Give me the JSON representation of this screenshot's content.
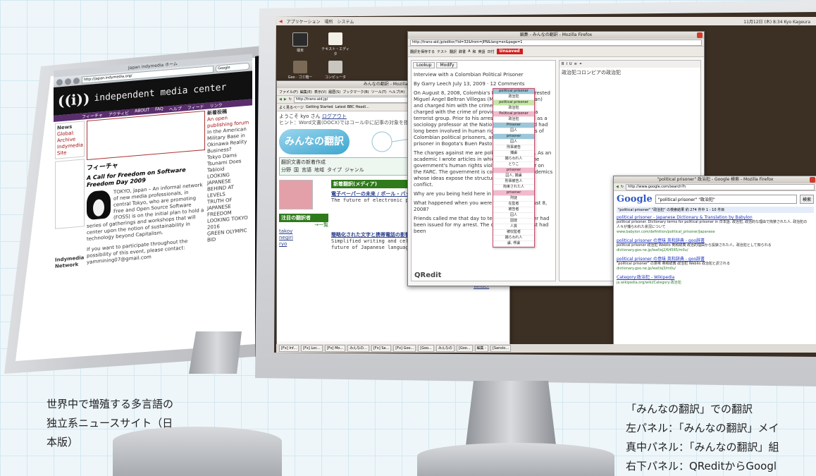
{
  "captions": {
    "left": {
      "line1": "世界中で増殖する多言語の",
      "line2": "独立系ニュースサイト（日",
      "line3": "本版）"
    },
    "right": {
      "line1": "「みんなの翻訳」での翻訳",
      "line2": "左パネル：「みんなの翻訳」メイ",
      "line3": "真中パネル：「みんなの翻訳」組",
      "line4": "右下パネル：QReditからGoogl"
    }
  },
  "left_browser": {
    "window_title": "Japan indymedia ホーム",
    "url": "http://japan.indymedia.org/",
    "search_placeholder": "Google",
    "site_logo": "((i))",
    "site_name": "independent media center",
    "nav": [
      "フィーチャ",
      "アクティビ",
      "ABOUT",
      "FAQ",
      "ヘルプ",
      "フィード",
      "リンク"
    ],
    "left_heading": "News",
    "left_items": [
      "Global: Archive",
      "Indymedia Site"
    ],
    "article_heading": "フィーチャ",
    "article_title": "A Call for Freedom on Software Freedom Day 2009",
    "article_body": "TOKYO, Japan – An informal network of new media professionals, in central Tokyo, who are promoting Free and Open Source Software (FOSS) is on the initial plan to hold a series of gatherings and workshops that will center upon the notion of sustainability in technology beyond Capitalism.",
    "article_footer": "If you want to participate throughout the possibility of this event, please contact: yammining07@gmail.com",
    "right_heading": "新着投稿",
    "right_items": [
      "An open publishing forum",
      "In the American Military Base in Okinawa Reality Business?",
      "Tokyo Dams",
      "Tsunami Does Tabloid",
      "LOOKING JAPANESE BEHIND AT LEVELS",
      "TRUTH OF JAPANESE FREEDOM",
      "LOOKING TOKYO 2016",
      "GREEN OLYMPIC BID"
    ],
    "bottom_label": "Indymedia Network"
  },
  "right_screen": {
    "top_panel": {
      "menu": [
        "アプリケーション",
        "場所",
        "システム"
      ],
      "status": "11月12日 (木) 8:34  Kyo Kageura"
    },
    "desktop_icons": [
      "端末",
      "テキスト・エディタ",
      "Geo · ゴミ箱ー",
      "コンピュータ"
    ],
    "minna_window": {
      "title": "みんなの翻訳 - Mozilla Firefox",
      "menu": [
        "ファイル(F)",
        "編集(E)",
        "表示(V)",
        "履歴(S)",
        "ブックマーク(B)",
        "ツール(T)",
        "ヘルプ(H)"
      ],
      "url": "http://trans-aid.jp/",
      "bookmarks": [
        "よく見るページ",
        "Getting Started",
        "Latest BBC Headl..."
      ],
      "welcome": "ようこそ kyo さん",
      "logout": "ログアウト",
      "notice": "ヒント：Word文書(DOCX)ではコール中に記事の対象を指定することができます。",
      "logo": "みんなの翻訳",
      "search_label": "翻訳文書の新着作成",
      "categories": [
        "分野",
        "国",
        "言語",
        "地域",
        "タイプ",
        "ジャンル"
      ],
      "news_heading": "新着翻訳(メディア)",
      "news_title": "電子ペーパーの未来 / ポール・バッジ",
      "news_subtitle": "The future of electronic paper / Paul Biba",
      "news_title2": "簡略化された文字と携帯電話の影響 / ポール・ロスマン",
      "news_subtitle2": "Simplified writing and cellphone novels: The future of Japanese language? / David Rothman",
      "members_heading": "注目の翻訳者",
      "members_more": "→一覧",
      "members": [
        "takoy",
        "negiri",
        "ryo"
      ],
      "side_title": "G7 vs. G5 in charts / Rebecca Wilder"
    },
    "qredit_window": {
      "title": "編集 - みんなの翻訳 - Mozilla Firefox",
      "url": "http://trans-aid.jp/editor/?id=32&from=JPN&lang=en&page=1",
      "buttons": [
        "翻訳を保存する",
        "テスト",
        "翻訳",
        "辞書",
        "A",
        "和",
        "英語",
        "日付"
      ],
      "unsaved": "Unsaved",
      "tabs": [
        "Lookup",
        "Modify"
      ],
      "right_heading": "政治犯コロンビアの政治犯",
      "logo": "QRedit",
      "paragraphs": [
        "Interview with a Colombian Political Prisoner",
        "By Garry Leech July 13, 2009 · 12 Comments",
        "On August 8, 2008, Colombia's National Police arrested Miguel Angel Beltran Villegas (Miguel Angel Beltran) and charged him with the crime of rebellion and charged with the crime of providing Dundinghay a terrorist group. Prior to his arrest, Beltran worked as a sociology professor at the National University and had long been involved in human rights and the rights of Colombian political prisoners, as an advocate, a prisoner in Bogota's Buen Pastor Prison.",
        "The charges against me are politically motivated. As an academic I wrote articles in which I denounced the government's human rights violations and its war on the FARC. The government is concerned with academics whose ideas expose the structural causes of the conflict.",
        "Why are you being held here in Buen Pastor?",
        "What happened when you were arrested on August 8, 2008?",
        "Friends called me that day to tell me that an order had been issued for my arrest. The order for my arrest had been"
      ],
      "popup": [
        "political prisoner",
        "政治犯",
        "political prisoner",
        "政治犯",
        "Political prisoner",
        "政治犯",
        "Prisoner",
        "囚人",
        "prisoner",
        "囚人",
        "刑事被告",
        "捕虜",
        "捕らわれ人",
        "とりこ",
        "prisoner",
        "囚人, 捕虜",
        "刑事被告人",
        "拘束された人",
        "prisoner",
        "刑徒",
        "在監者",
        "被告者",
        "囚人",
        "因徒",
        "人質",
        "被収監者",
        "捕らわれ人",
        "虜, 俘虜"
      ]
    },
    "google_window": {
      "title": "\"political prisoner\" 政治犯 - Google 検索 - Mozilla Firefox",
      "url": "http://www.google.com/search?h",
      "search_value": "\"political prisoner\" \"政治犯\"",
      "search_button": "検索",
      "result_bar": "\"political prisoner\" \"政治犯\" の検索結果 約 274 件中 1 - 10 件目",
      "results": [
        {
          "title": "political prisoner - Japanese Dictionary & Translation by Babylon",
          "url": "www.babylon.com/definition/political_prisoner/Japanese",
          "text": "political prisoner. Dictionary terms for political prisoner in 日本語. 政治犯, 政治的な理由で拘禁された人. 政治犯の人々が捕らわれた状況について"
        },
        {
          "title": "political prisoner の意味 英和辞典 - goo辞書",
          "url": "dictionary.goo.ne.jp/leaf/ej2/64565/m0u/",
          "text": "political prisoner 政治犯 Weblio 英和辞典 政治的理由から投獄された人。政治犯として知られる"
        },
        {
          "title": "political prisoner の意味 英和辞典 - goo辞書",
          "url": "dictionary.goo.ne.jp/leaf/ej3/m0u/",
          "text": "\"political prisoner\" の意味 英和辞典 政治犯 Weblio 政治犯と訳される"
        },
        {
          "title": "Category:政治犯 - Wikipedia",
          "url": "ja.wikipedia.org/wiki/Category:政治犯",
          "text": ""
        }
      ]
    },
    "taskbar": [
      "[Fx] Inf...",
      "[Fx] Loc...",
      "[Fx] Mo...",
      "みんなの...",
      "[Fx] Sa...",
      "[Fx] Goo...",
      "[Goo...",
      "みんなの",
      "[Goo...",
      "編集 -",
      "[Sanslo..."
    ]
  }
}
